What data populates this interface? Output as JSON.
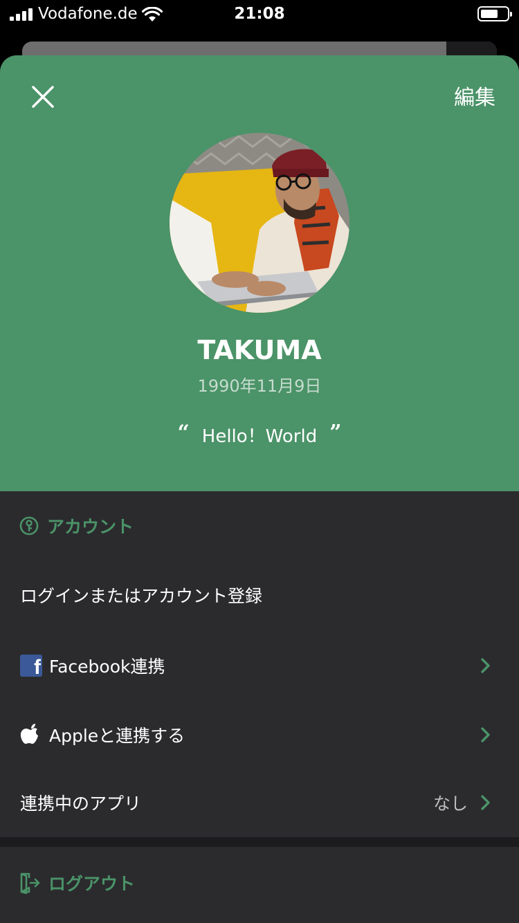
{
  "status_bar": {
    "carrier": "Vodafone.de",
    "time": "21:08"
  },
  "header": {
    "edit_label": "編集",
    "name": "TAKUMA",
    "birthday": "1990年11月9日",
    "quote_open": "“",
    "quote_text": "Hello！World",
    "quote_close": "”"
  },
  "account": {
    "section_title": "アカウント",
    "login_label": "ログインまたはアカウント登録",
    "facebook_label": "Facebook連携",
    "apple_label": "Appleと連携する",
    "linked_apps_label": "連携中のアプリ",
    "linked_apps_value": "なし"
  },
  "logout": {
    "label": "ログアウト"
  },
  "colors": {
    "accent_green": "#4b9368",
    "dark_bg": "#2b2b2e"
  }
}
